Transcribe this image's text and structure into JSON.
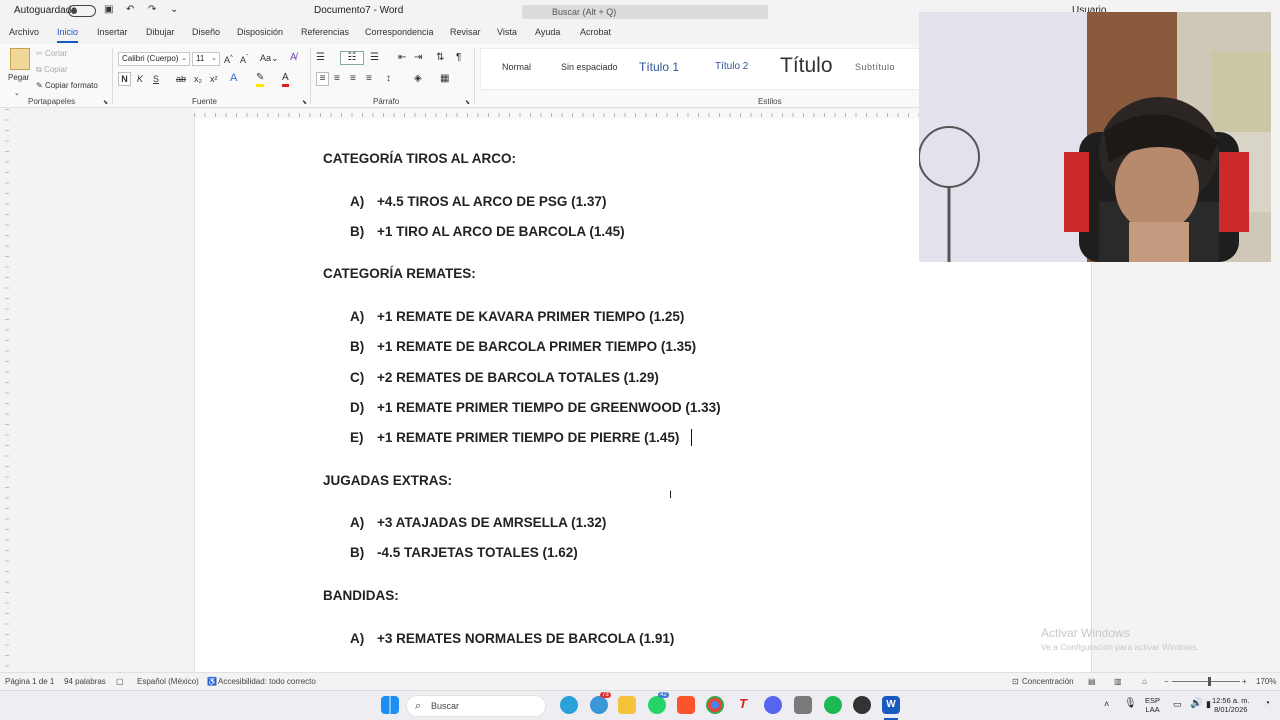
{
  "titlebar": {
    "autosave": "Autoguardado",
    "doc_title": "Documento7 - Word",
    "search_placeholder": "Buscar (Alt + Q)",
    "user": "Usuario"
  },
  "menu": {
    "tabs": [
      "Archivo",
      "Inicio",
      "Insertar",
      "Dibujar",
      "Diseño",
      "Disposición",
      "Referencias",
      "Correspondencia",
      "Revisar",
      "Vista",
      "Ayuda",
      "Acrobat"
    ],
    "active": "Inicio"
  },
  "ribbon": {
    "clipboard": {
      "paste": "Pegar",
      "cut": "Cortar",
      "copy": "Copiar",
      "format_painter": "Copiar formato",
      "label": "Portapapeles"
    },
    "font": {
      "name": "Calibri (Cuerpo)",
      "size": "11",
      "label": "Fuente",
      "bold": "N",
      "italic": "K",
      "underline": "S"
    },
    "paragraph": {
      "label": "Párrafo"
    },
    "styles": {
      "label": "Estilos",
      "items": [
        "Normal",
        "Sin espaciado",
        "Título 1",
        "Título 2",
        "Título",
        "Subtítulo"
      ]
    }
  },
  "document": {
    "sections": [
      {
        "heading": "CATEGORÍA TIROS AL ARCO:",
        "items": [
          {
            "label": "A)",
            "text": "+4.5 TIROS AL ARCO DE PSG (1.37)"
          },
          {
            "label": "B)",
            "text": "+1 TIRO AL ARCO DE BARCOLA (1.45)"
          }
        ]
      },
      {
        "heading": "CATEGORÍA REMATES:",
        "items": [
          {
            "label": "A)",
            "text": "+1 REMATE DE KAVARA PRIMER TIEMPO (1.25)"
          },
          {
            "label": "B)",
            "text": "+1 REMATE DE BARCOLA PRIMER TIEMPO (1.35)"
          },
          {
            "label": "C)",
            "text": "+2 REMATES DE BARCOLA TOTALES (1.29)"
          },
          {
            "label": "D)",
            "text": "+1 REMATE PRIMER TIEMPO DE GREENWOOD (1.33)"
          },
          {
            "label": "E)",
            "text": "+1 REMATE PRIMER TIEMPO DE PIERRE (1.45)"
          }
        ]
      },
      {
        "heading": "JUGADAS EXTRAS:",
        "items": [
          {
            "label": "A)",
            "text": "+3 ATAJADAS DE AMRSELLA (1.32)"
          },
          {
            "label": "B)",
            "text": "-4.5 TARJETAS TOTALES (1.62)"
          }
        ]
      },
      {
        "heading": "BANDIDAS:",
        "items": [
          {
            "label": "A)",
            "text": "+3 REMATES NORMALES DE BARCOLA (1.91)"
          }
        ]
      }
    ]
  },
  "watermark": {
    "title": "Activar Windows",
    "subtitle": "Ve a Configuración para activar Windows."
  },
  "statusbar": {
    "page": "Página 1 de 1",
    "words": "94 palabras",
    "language": "Español (México)",
    "accessibility": "Accesibilidad: todo correcto",
    "focus": "Concentración",
    "zoom": "170%"
  },
  "taskbar": {
    "search_placeholder": "Buscar",
    "lang_top": "ESP",
    "lang_bottom": "LAA",
    "time": "12:56 a. m.",
    "date": "8/01/2026",
    "badge_1": "73",
    "badge_2": "42"
  },
  "colors": {
    "accent": "#185abd",
    "word_blue": "#185abd",
    "text": "#222222"
  }
}
